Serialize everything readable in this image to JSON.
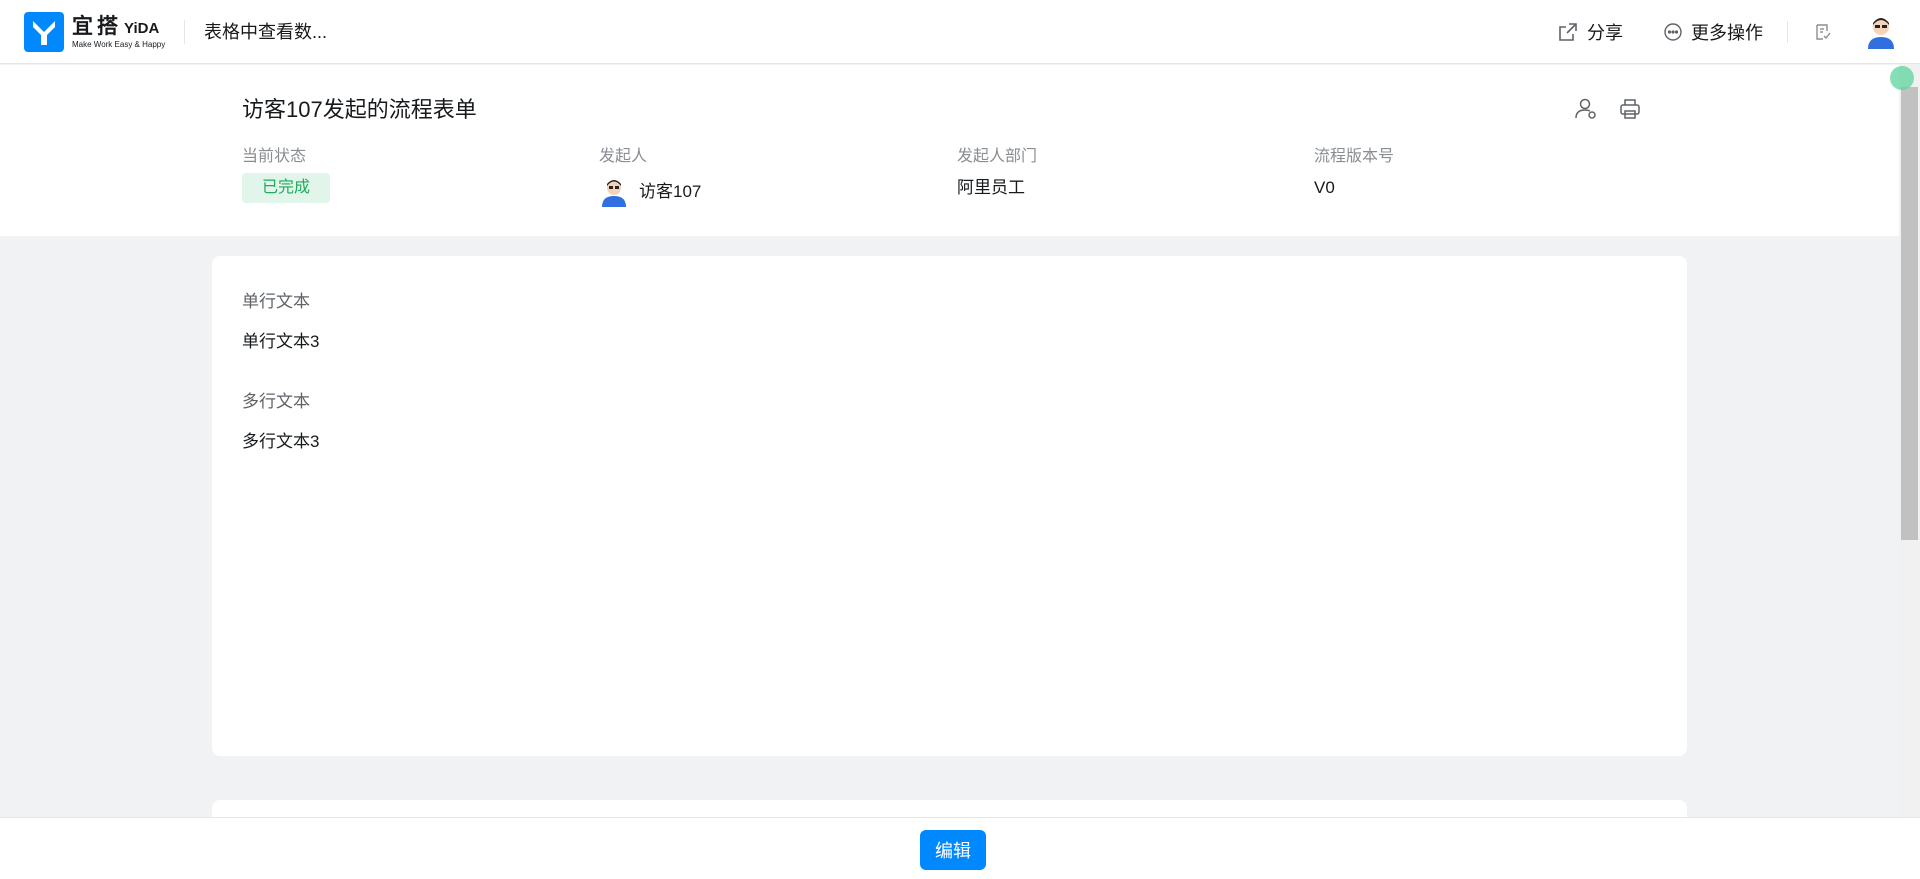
{
  "topbar": {
    "logo_cn": "宜搭",
    "logo_en": "YiDA",
    "logo_tagline": "Make Work Easy & Happy",
    "app_title": "表格中查看数...",
    "share_label": "分享",
    "more_label": "更多操作"
  },
  "header": {
    "title": "访客107发起的流程表单",
    "meta": {
      "status_label": "当前状态",
      "status_value": "已完成",
      "initiator_label": "发起人",
      "initiator_value": "访客107",
      "department_label": "发起人部门",
      "department_value": "阿里员工",
      "version_label": "流程版本号",
      "version_value": "V0"
    }
  },
  "form": {
    "fields": [
      {
        "label": "单行文本",
        "value": "单行文本3"
      },
      {
        "label": "多行文本",
        "value": "多行文本3"
      }
    ]
  },
  "footer": {
    "edit_label": "编辑"
  },
  "colors": {
    "brand": "#0089ff",
    "status_bg": "#e2f5ea",
    "status_text": "#1fab5e"
  }
}
